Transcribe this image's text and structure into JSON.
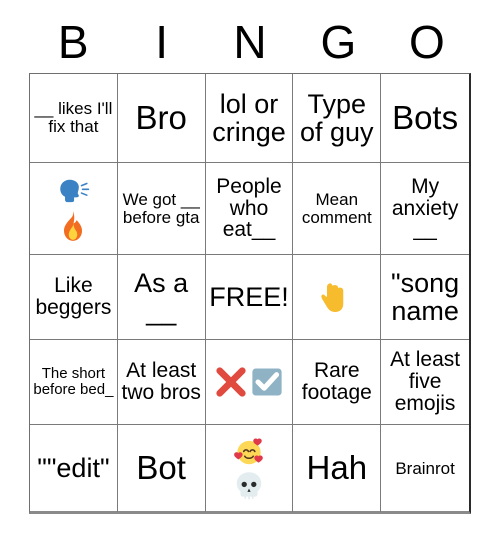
{
  "card": {
    "title": "BINGO",
    "header_letters": [
      "B",
      "I",
      "N",
      "G",
      "O"
    ],
    "free_space_label": "FREE!",
    "grid_size": "5x5",
    "colors": {
      "background": "#ffffff",
      "text": "#000000",
      "gridline": "#7a7a7a",
      "border": "#2b2b2b",
      "emoji_blue": "#3b82c4",
      "emoji_fire_orange": "#f26d21",
      "emoji_fire_yellow": "#ffd33d",
      "emoji_red_x": "#e04a3f",
      "emoji_check_box": "#8fb3c4",
      "emoji_hand_yellow": "#f7bb2e",
      "emoji_heart_red": "#e0394a",
      "emoji_skull": "#e3edf0"
    }
  },
  "cells": [
    {
      "id": "b1",
      "column": "B",
      "row": 1,
      "text": "__ likes I'll fix that",
      "size": "sm",
      "type": "text"
    },
    {
      "id": "i1",
      "column": "I",
      "row": 1,
      "text": "Bro",
      "size": "xl",
      "type": "text"
    },
    {
      "id": "n1",
      "column": "N",
      "row": 1,
      "text": "lol or cringe",
      "size": "lg",
      "type": "text"
    },
    {
      "id": "g1",
      "column": "G",
      "row": 1,
      "text": "Type of guy",
      "size": "lg",
      "type": "text"
    },
    {
      "id": "o1",
      "column": "O",
      "row": 1,
      "text": "Bots",
      "size": "xl",
      "type": "text"
    },
    {
      "id": "b2",
      "column": "B",
      "row": 2,
      "text": "",
      "size": "md",
      "type": "emoji",
      "emojis": [
        "speaking-head",
        "fire"
      ],
      "layout": "stack"
    },
    {
      "id": "i2",
      "column": "I",
      "row": 2,
      "text": "We got __ before gta",
      "size": "sm",
      "type": "text"
    },
    {
      "id": "n2",
      "column": "N",
      "row": 2,
      "text": "People who eat__",
      "size": "md",
      "type": "text"
    },
    {
      "id": "g2",
      "column": "G",
      "row": 2,
      "text": "Mean comment",
      "size": "sm",
      "type": "text"
    },
    {
      "id": "o2",
      "column": "O",
      "row": 2,
      "text": "My anxiety __",
      "size": "md",
      "type": "text"
    },
    {
      "id": "b3",
      "column": "B",
      "row": 3,
      "text": "Like beggers",
      "size": "md",
      "type": "text"
    },
    {
      "id": "i3",
      "column": "I",
      "row": 3,
      "text": "As a __",
      "size": "lg",
      "type": "text"
    },
    {
      "id": "n3",
      "column": "N",
      "row": 3,
      "text": "FREE!",
      "size": "lg",
      "type": "free"
    },
    {
      "id": "g3",
      "column": "G",
      "row": 3,
      "text": "",
      "size": "md",
      "type": "emoji",
      "emojis": [
        "backhand-index-pointing-down"
      ],
      "layout": "single"
    },
    {
      "id": "o3",
      "column": "O",
      "row": 3,
      "text": "\"song name",
      "size": "lg",
      "type": "text"
    },
    {
      "id": "b4",
      "column": "B",
      "row": 4,
      "text": "The short before bed_",
      "size": "xs",
      "type": "text"
    },
    {
      "id": "i4",
      "column": "I",
      "row": 4,
      "text": "At least two bros",
      "size": "md",
      "type": "text"
    },
    {
      "id": "n4",
      "column": "N",
      "row": 4,
      "text": "",
      "size": "md",
      "type": "emoji",
      "emojis": [
        "cross-mark",
        "ballot-box-with-check"
      ],
      "layout": "row"
    },
    {
      "id": "g4",
      "column": "G",
      "row": 4,
      "text": "Rare footage",
      "size": "md",
      "type": "text"
    },
    {
      "id": "o4",
      "column": "O",
      "row": 4,
      "text": "At least five emojis",
      "size": "md",
      "type": "text"
    },
    {
      "id": "b5",
      "column": "B",
      "row": 5,
      "text": "\"\"edit\"",
      "size": "lg",
      "type": "text"
    },
    {
      "id": "i5",
      "column": "I",
      "row": 5,
      "text": "Bot",
      "size": "xl",
      "type": "text"
    },
    {
      "id": "n5",
      "column": "N",
      "row": 5,
      "text": "",
      "size": "md",
      "type": "emoji",
      "emojis": [
        "smiling-face-with-hearts",
        "skull"
      ],
      "layout": "stack"
    },
    {
      "id": "g5",
      "column": "G",
      "row": 5,
      "text": "Hah",
      "size": "xl",
      "type": "text"
    },
    {
      "id": "o5",
      "column": "O",
      "row": 5,
      "text": "Brainrot",
      "size": "sm",
      "type": "text"
    }
  ]
}
